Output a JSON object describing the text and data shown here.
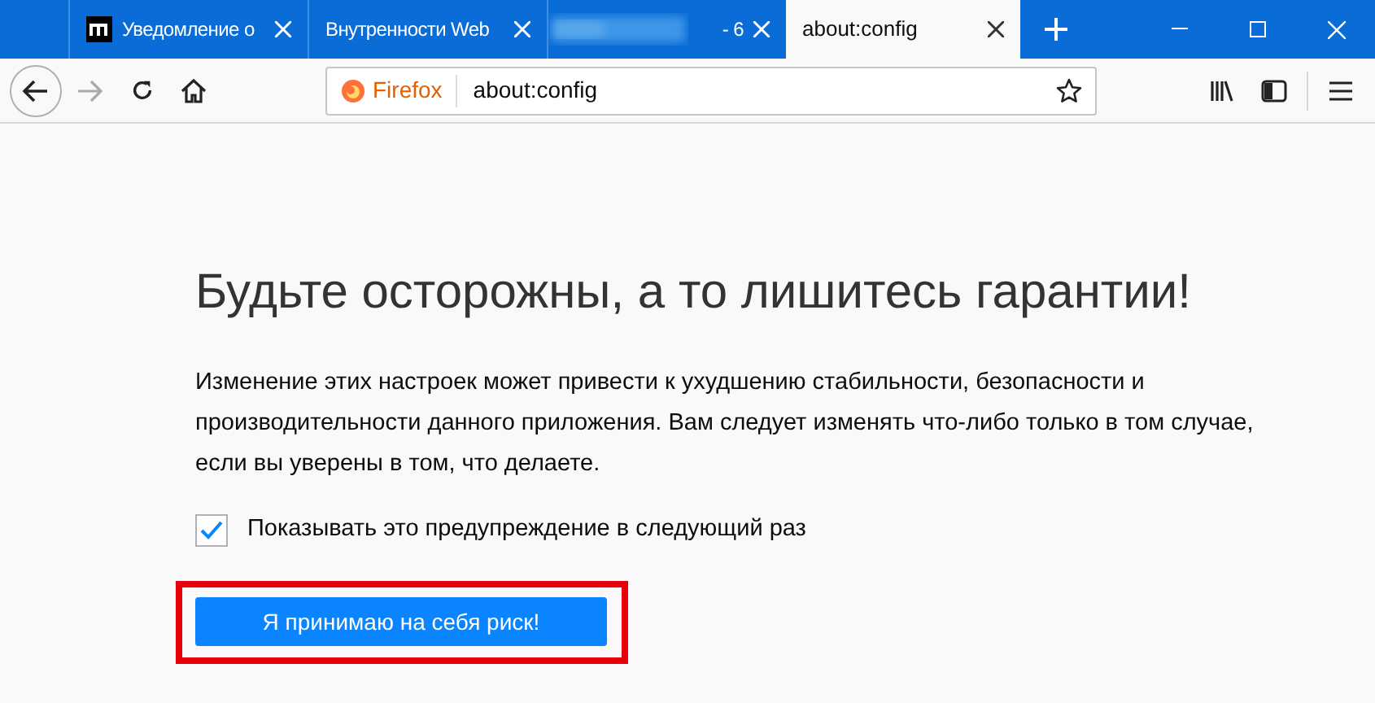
{
  "tabs": [
    {
      "kind": "site",
      "title": "Уведомление о",
      "selected": false
    },
    {
      "kind": "plain",
      "title": "Внутренности Web",
      "selected": false
    },
    {
      "kind": "blurred",
      "title": "- 6",
      "selected": false
    },
    {
      "kind": "plain",
      "title": "about:config",
      "selected": true
    }
  ],
  "toolbar": {
    "identity": "Firefox",
    "url": "about:config"
  },
  "page": {
    "heading": "Будьте осторожны, а то лишитесь гарантии!",
    "text": "Изменение этих настроек может привести к ухудшению стабильности, безопасности и производительности данного приложения. Вам следует изменять что-либо только в том случае, если вы уверены в том, что делаете.",
    "checkbox": {
      "label": "Показывать это предупреждение в следующий раз",
      "checked": true
    },
    "button": "Я принимаю на себя риск!"
  }
}
